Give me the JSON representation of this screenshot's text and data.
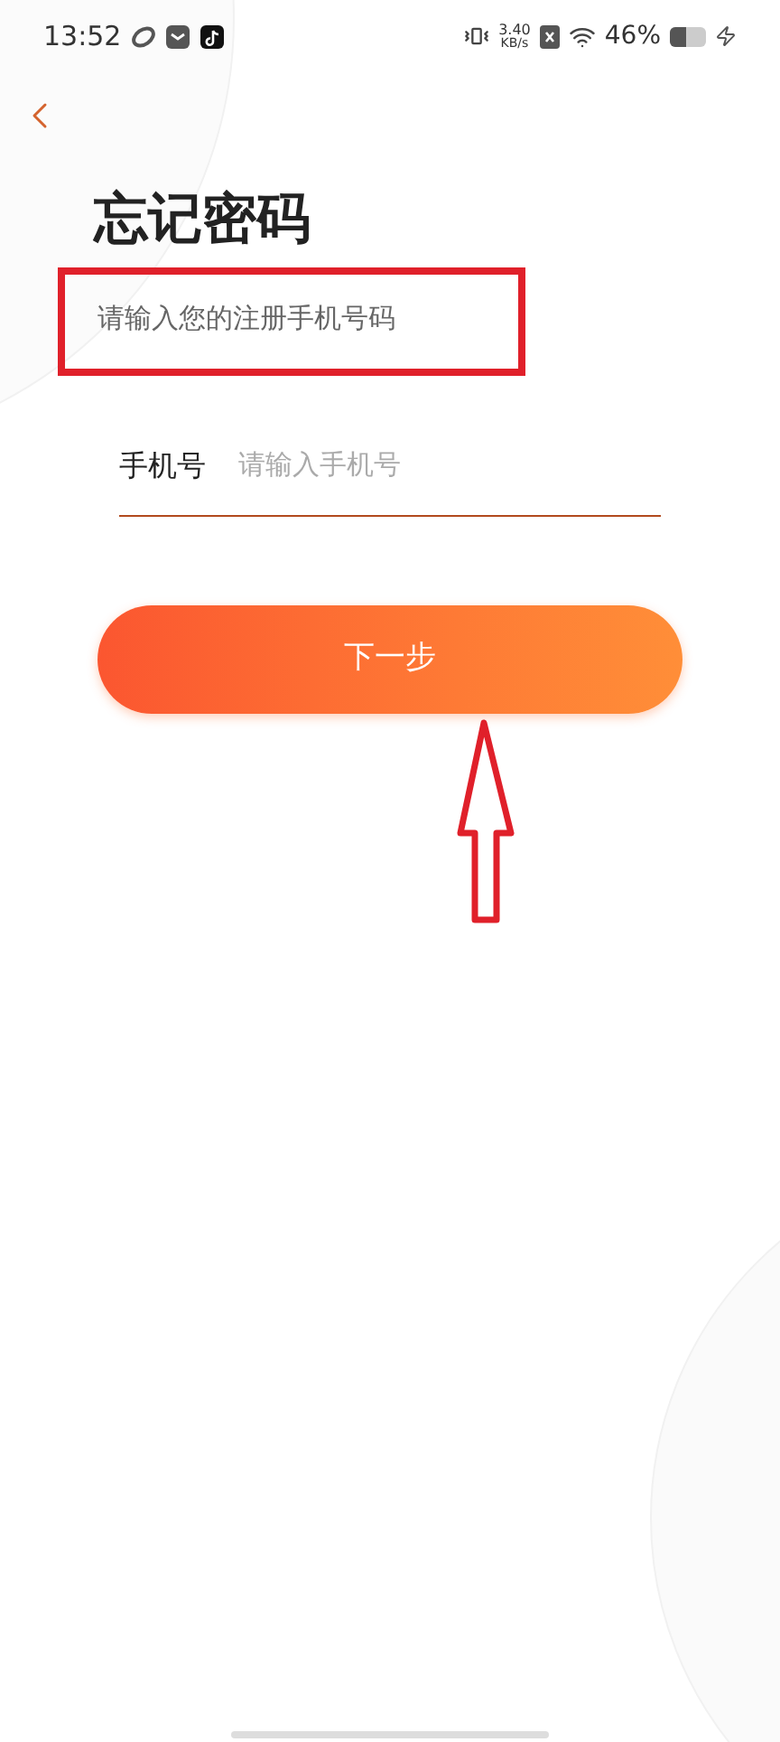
{
  "status_bar": {
    "time": "13:52",
    "net_speed_value": "3.40",
    "net_speed_unit": "KB/s",
    "battery": "46%",
    "battery_meter": {
      "level": 0.46
    }
  },
  "page": {
    "title": "忘记密码",
    "subtitle": "请输入您的注册手机号码",
    "subtitle_highlighted": true
  },
  "form": {
    "phone_label": "手机号",
    "phone_placeholder": "请输入手机号"
  },
  "next_button": "下一步",
  "annotation_arrow": true
}
